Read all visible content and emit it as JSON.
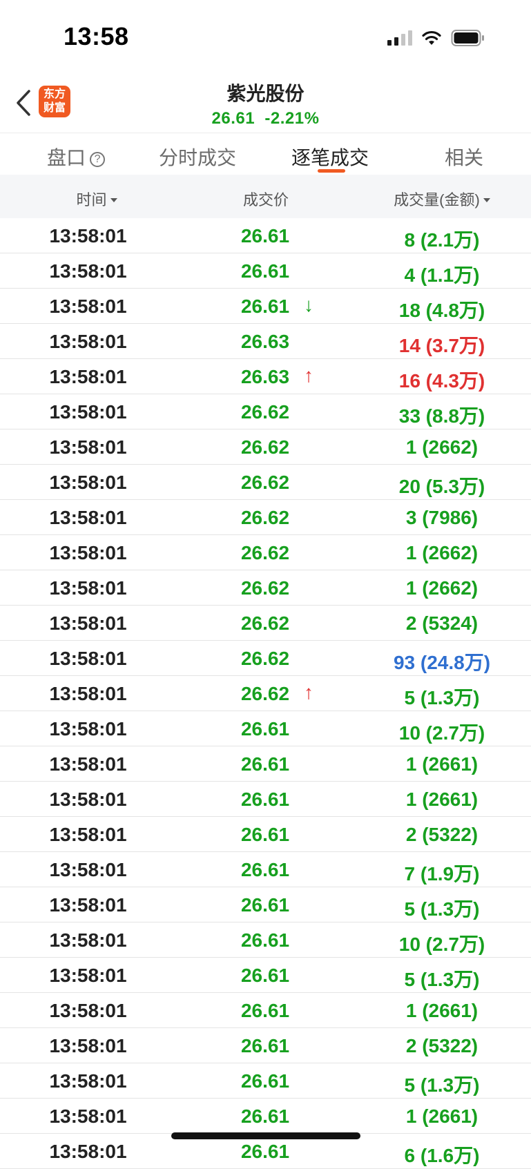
{
  "status_bar": {
    "time": "13:58"
  },
  "header": {
    "logo_line1": "东方",
    "logo_line2": "财富",
    "stock_name": "紫光股份",
    "quote": "26.61  -2.21%"
  },
  "tabs": [
    {
      "label": "盘口",
      "active": false
    },
    {
      "label": "分时成交",
      "active": false
    },
    {
      "label": "逐笔成交",
      "active": true
    },
    {
      "label": "相关",
      "active": false
    }
  ],
  "columns": {
    "time": "时间",
    "price": "成交价",
    "volume": "成交量(金额)"
  },
  "colors": {
    "green": "#17a01f",
    "red": "#e03131",
    "blue": "#2f6fd0",
    "accent": "#f05a22"
  },
  "rows": [
    {
      "time": "13:58:01",
      "price": "26.61",
      "price_color": "green",
      "arrow": "",
      "volume": "8 (2.1万)",
      "vol_color": "green"
    },
    {
      "time": "13:58:01",
      "price": "26.61",
      "price_color": "green",
      "arrow": "",
      "volume": "4 (1.1万)",
      "vol_color": "green"
    },
    {
      "time": "13:58:01",
      "price": "26.61",
      "price_color": "green",
      "arrow": "down",
      "volume": "18 (4.8万)",
      "vol_color": "green"
    },
    {
      "time": "13:58:01",
      "price": "26.63",
      "price_color": "green",
      "arrow": "",
      "volume": "14 (3.7万)",
      "vol_color": "red"
    },
    {
      "time": "13:58:01",
      "price": "26.63",
      "price_color": "green",
      "arrow": "up",
      "volume": "16 (4.3万)",
      "vol_color": "red"
    },
    {
      "time": "13:58:01",
      "price": "26.62",
      "price_color": "green",
      "arrow": "",
      "volume": "33 (8.8万)",
      "vol_color": "green"
    },
    {
      "time": "13:58:01",
      "price": "26.62",
      "price_color": "green",
      "arrow": "",
      "volume": "1 (2662)",
      "vol_color": "green"
    },
    {
      "time": "13:58:01",
      "price": "26.62",
      "price_color": "green",
      "arrow": "",
      "volume": "20 (5.3万)",
      "vol_color": "green"
    },
    {
      "time": "13:58:01",
      "price": "26.62",
      "price_color": "green",
      "arrow": "",
      "volume": "3 (7986)",
      "vol_color": "green"
    },
    {
      "time": "13:58:01",
      "price": "26.62",
      "price_color": "green",
      "arrow": "",
      "volume": "1 (2662)",
      "vol_color": "green"
    },
    {
      "time": "13:58:01",
      "price": "26.62",
      "price_color": "green",
      "arrow": "",
      "volume": "1 (2662)",
      "vol_color": "green"
    },
    {
      "time": "13:58:01",
      "price": "26.62",
      "price_color": "green",
      "arrow": "",
      "volume": "2 (5324)",
      "vol_color": "green"
    },
    {
      "time": "13:58:01",
      "price": "26.62",
      "price_color": "green",
      "arrow": "",
      "volume": "93 (24.8万)",
      "vol_color": "blue"
    },
    {
      "time": "13:58:01",
      "price": "26.62",
      "price_color": "green",
      "arrow": "up",
      "volume": "5 (1.3万)",
      "vol_color": "green"
    },
    {
      "time": "13:58:01",
      "price": "26.61",
      "price_color": "green",
      "arrow": "",
      "volume": "10 (2.7万)",
      "vol_color": "green"
    },
    {
      "time": "13:58:01",
      "price": "26.61",
      "price_color": "green",
      "arrow": "",
      "volume": "1 (2661)",
      "vol_color": "green"
    },
    {
      "time": "13:58:01",
      "price": "26.61",
      "price_color": "green",
      "arrow": "",
      "volume": "1 (2661)",
      "vol_color": "green"
    },
    {
      "time": "13:58:01",
      "price": "26.61",
      "price_color": "green",
      "arrow": "",
      "volume": "2 (5322)",
      "vol_color": "green"
    },
    {
      "time": "13:58:01",
      "price": "26.61",
      "price_color": "green",
      "arrow": "",
      "volume": "7 (1.9万)",
      "vol_color": "green"
    },
    {
      "time": "13:58:01",
      "price": "26.61",
      "price_color": "green",
      "arrow": "",
      "volume": "5 (1.3万)",
      "vol_color": "green"
    },
    {
      "time": "13:58:01",
      "price": "26.61",
      "price_color": "green",
      "arrow": "",
      "volume": "10 (2.7万)",
      "vol_color": "green"
    },
    {
      "time": "13:58:01",
      "price": "26.61",
      "price_color": "green",
      "arrow": "",
      "volume": "5 (1.3万)",
      "vol_color": "green"
    },
    {
      "time": "13:58:01",
      "price": "26.61",
      "price_color": "green",
      "arrow": "",
      "volume": "1 (2661)",
      "vol_color": "green"
    },
    {
      "time": "13:58:01",
      "price": "26.61",
      "price_color": "green",
      "arrow": "",
      "volume": "2 (5322)",
      "vol_color": "green"
    },
    {
      "time": "13:58:01",
      "price": "26.61",
      "price_color": "green",
      "arrow": "",
      "volume": "5 (1.3万)",
      "vol_color": "green"
    },
    {
      "time": "13:58:01",
      "price": "26.61",
      "price_color": "green",
      "arrow": "",
      "volume": "1 (2661)",
      "vol_color": "green"
    },
    {
      "time": "13:58:01",
      "price": "26.61",
      "price_color": "green",
      "arrow": "",
      "volume": "6 (1.6万)",
      "vol_color": "green"
    }
  ]
}
